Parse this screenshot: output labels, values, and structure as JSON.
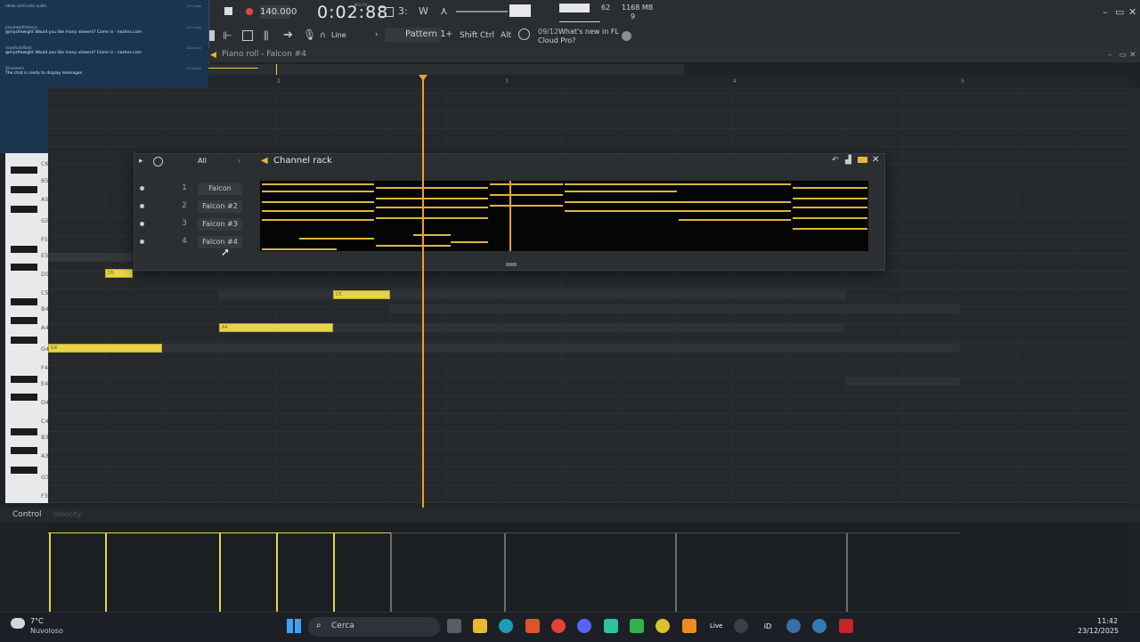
{
  "toolbar": {
    "tempo": "140.000",
    "time": "0:02:88",
    "time_unit": "M:S:CS",
    "cpu": "62",
    "memory": "1168 MB",
    "voices": "9",
    "mode_label": "Line",
    "pattern_label": "Pattern 1",
    "shift_label": "Shift",
    "ctrl_label": "Ctrl",
    "alt_label": "Alt",
    "news_date": "09/12",
    "news_text_1": "What's new in FL",
    "news_text_2": "Cloud Pro?"
  },
  "chat": {
    "messages": [
      {
        "user": "tiktok.com/rustic.audio",
        "text": "",
        "time": "12:11 pm"
      },
      {
        "user": "pauutowdintresys",
        "text": "@mysfiewight Would you like many viewers? Come in - nezhns.com",
        "time": "12:11 pm"
      },
      {
        "user": "siayafurbilSoot",
        "text": "@mysfiewight Would you like many viewers? Come in - nezhns.com",
        "time": "12:14 pm"
      },
      {
        "user": "Streamers",
        "text": "The chat is ready to display messages",
        "time": "12:14 pm"
      }
    ]
  },
  "piano_roll": {
    "title": "Piano roll - Falcon #4",
    "bars": [
      "2",
      "3",
      "4",
      "5"
    ],
    "keys": [
      "C6",
      "B5",
      "A5",
      "G5",
      "F5",
      "E5",
      "D5",
      "C5",
      "B4",
      "A4",
      "G4",
      "F4",
      "E4",
      "D4",
      "C4",
      "B3",
      "A3",
      "G3",
      "F3"
    ],
    "notes": [
      {
        "label": "D5"
      },
      {
        "label": "C5"
      },
      {
        "label": "A4"
      },
      {
        "label": "G4"
      }
    ]
  },
  "channel_rack": {
    "title": "Channel rack",
    "filter": "All",
    "channels": [
      {
        "num": "1",
        "name": "Falcon"
      },
      {
        "num": "2",
        "name": "Falcon #2"
      },
      {
        "num": "3",
        "name": "Falcon #3"
      },
      {
        "num": "4",
        "name": "Falcon #4"
      }
    ]
  },
  "control": {
    "label": "Control",
    "param": "Velocity"
  },
  "taskbar": {
    "weather_temp": "7°C",
    "weather_desc": "Nuvoloso",
    "search_placeholder": "Cerca",
    "live_label": "Live",
    "clock_time": "11:42",
    "clock_date": "23/12/2025"
  },
  "colors": {
    "note": "#e8d44a",
    "playhead": "#f0a020",
    "chat_bg": "#1b3551"
  }
}
